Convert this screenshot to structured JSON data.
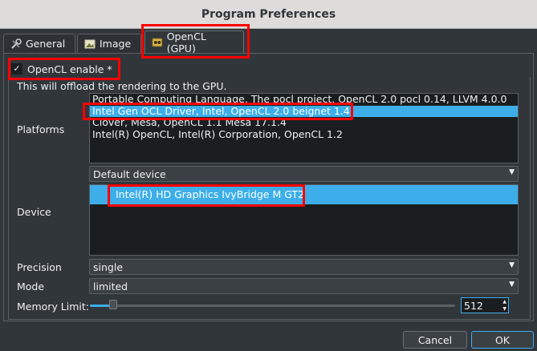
{
  "window": {
    "title": "Program Preferences"
  },
  "tabs": [
    {
      "label": "General",
      "icon": "tools-icon"
    },
    {
      "label": "Image",
      "icon": "image-icon"
    },
    {
      "label": "OpenCL (GPU)",
      "icon": "gpu-icon",
      "active": true
    }
  ],
  "opencl": {
    "enable_label": "OpenCL enable *",
    "enable_checked": true,
    "checkmark": "✓",
    "description": "This will offload the rendering to the GPU.",
    "platforms_label": "Platforms",
    "platforms": [
      "Portable Computing Language, The pocl project, OpenCL 2.0 pocl 0.14, LLVM 4.0.0",
      "Intel Gen OCL Driver, Intel, OpenCL 2.0 beignet 1.4",
      "Clover, Mesa, OpenCL 1.1 Mesa 17.1.4",
      "Intel(R) OpenCL, Intel(R) Corporation, OpenCL 1.2"
    ],
    "selected_platform": 1,
    "device_label": "Device",
    "device_combo": "Default device",
    "devices": [
      "Intel(R) HD Graphics IvyBridge M GT2"
    ],
    "precision_label": "Precision",
    "precision_value": "single",
    "mode_label": "Mode",
    "mode_value": "limited",
    "memory_label": "Memory Limit:",
    "memory_value": "512"
  },
  "buttons": {
    "cancel": "Cancel",
    "ok": "OK"
  },
  "colors": {
    "accent": "#3daee9",
    "highlight": "#ff0000",
    "background": "#31363b"
  }
}
